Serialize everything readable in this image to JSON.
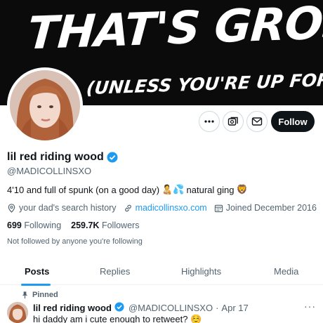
{
  "banner": {
    "line1": "THAT'S GROSS!",
    "line2": "(UNLESS YOU'RE UP FOR IT?)"
  },
  "actions": {
    "follow_label": "Follow"
  },
  "profile": {
    "display_name": "lil red riding wood",
    "handle": "@MADICOLLINSXO",
    "bio_text": "4'10 and full of spunk (on a good day)",
    "bio_emoji": "🧑‍🍼💦",
    "bio_tail": "natural ging",
    "bio_tail_emoji": "🦁",
    "location": "your dad's search history",
    "website": "madicollinsxo.com",
    "joined": "Joined December 2016",
    "following_count": "699",
    "following_label": "Following",
    "followers_count": "259.7K",
    "followers_label": "Followers",
    "not_followed": "Not followed by anyone you're following"
  },
  "tabs": [
    {
      "label": "Posts"
    },
    {
      "label": "Replies"
    },
    {
      "label": "Highlights"
    },
    {
      "label": "Media"
    }
  ],
  "tweet": {
    "pinned_label": "Pinned",
    "name": "lil red riding wood",
    "handle": "@MADICOLLINSXO",
    "separator": "·",
    "date": "Apr 17",
    "more": "···",
    "text": "hi daddy am i cute enough to retweet?",
    "text_emoji": "☺️"
  },
  "colors": {
    "accent": "#1d9bf0",
    "text": "#0f1419",
    "muted": "#536471",
    "banner": "#0b0b0b"
  }
}
